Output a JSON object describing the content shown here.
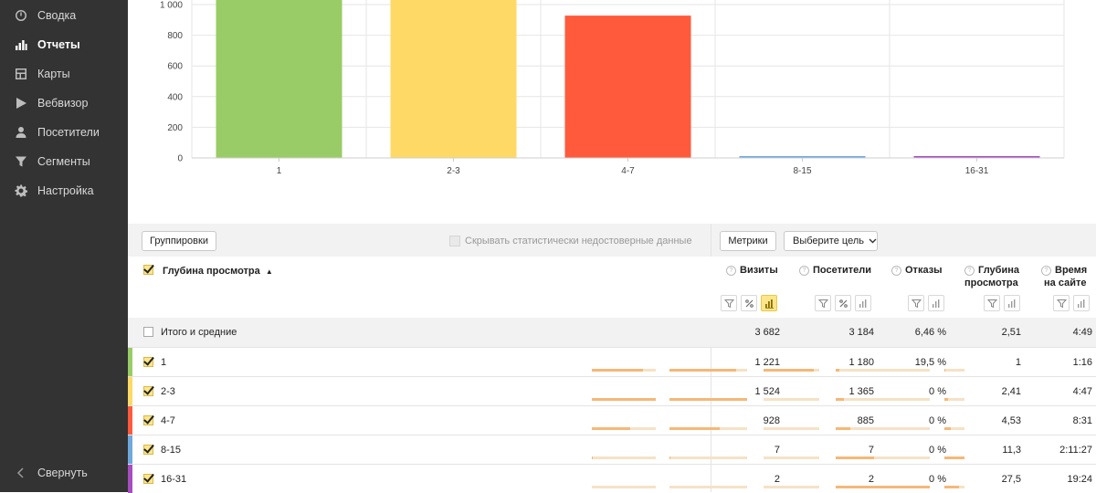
{
  "sidebar": {
    "items": [
      {
        "label": "Сводка",
        "icon": "dashboard-icon",
        "active": false
      },
      {
        "label": "Отчеты",
        "icon": "reports-icon",
        "active": true
      },
      {
        "label": "Карты",
        "icon": "maps-icon",
        "active": false
      },
      {
        "label": "Вебвизор",
        "icon": "play-icon",
        "active": false
      },
      {
        "label": "Посетители",
        "icon": "user-icon",
        "active": false
      },
      {
        "label": "Сегменты",
        "icon": "filter-icon",
        "active": false
      },
      {
        "label": "Настройка",
        "icon": "gear-icon",
        "active": false
      }
    ],
    "collapse_label": "Свернуть"
  },
  "chart_data": {
    "type": "bar",
    "categories": [
      "1",
      "2-3",
      "4-7",
      "8-15",
      "16-31"
    ],
    "values": [
      1221,
      1524,
      928,
      7,
      2
    ],
    "colors": [
      "#99cc66",
      "#ffd966",
      "#ff5a3c",
      "#6fa8dc",
      "#a64dbf"
    ],
    "yticks": [
      "0",
      "200",
      "400",
      "600",
      "800",
      "1 000"
    ],
    "ylim": [
      0,
      1000
    ],
    "grid": true
  },
  "toolbar": {
    "groupings_label": "Группировки",
    "hide_unreliable_label": "Скрывать статистически недостоверные данные",
    "metrics_label": "Метрики",
    "goal_label": "Выберите цель"
  },
  "table": {
    "dimension_header": "Глубина просмотра",
    "sort_indicator": "▲",
    "columns": [
      {
        "line1": "Визиты",
        "line2": ""
      },
      {
        "line1": "Посетители",
        "line2": ""
      },
      {
        "line1": "Отказы",
        "line2": ""
      },
      {
        "line1": "Глубина",
        "line2": "просмотра"
      },
      {
        "line1": "Время",
        "line2": "на сайте"
      }
    ],
    "qmark": "?",
    "total": {
      "label": "Итого и средние",
      "values": [
        "3 682",
        "3 184",
        "6,46 %",
        "2,51",
        "4:49"
      ]
    },
    "rows": [
      {
        "label": "1",
        "color": "#99cc66",
        "values": [
          "1 221",
          "1 180",
          "19,5 %",
          "1",
          "1:16"
        ],
        "bars": [
          0.8,
          0.86,
          0.9,
          0.04,
          0.06
        ]
      },
      {
        "label": "2-3",
        "color": "#ffd966",
        "values": [
          "1 524",
          "1 365",
          "0 %",
          "2,41",
          "4:47"
        ],
        "bars": [
          1.0,
          1.0,
          0,
          0.09,
          0.18
        ]
      },
      {
        "label": "4-7",
        "color": "#ff5a3c",
        "values": [
          "928",
          "885",
          "0 %",
          "4,53",
          "8:31"
        ],
        "bars": [
          0.6,
          0.65,
          0,
          0.16,
          0.32
        ]
      },
      {
        "label": "8-15",
        "color": "#6fa8dc",
        "values": [
          "7",
          "7",
          "0 %",
          "11,3",
          "2:11:27"
        ],
        "bars": [
          0.01,
          0.01,
          0,
          0.41,
          1.0
        ]
      },
      {
        "label": "16-31",
        "color": "#a64dbf",
        "values": [
          "2",
          "2",
          "0 %",
          "27,5",
          "19:24"
        ],
        "bars": [
          0,
          0,
          0,
          1.0,
          0.73
        ]
      }
    ]
  }
}
